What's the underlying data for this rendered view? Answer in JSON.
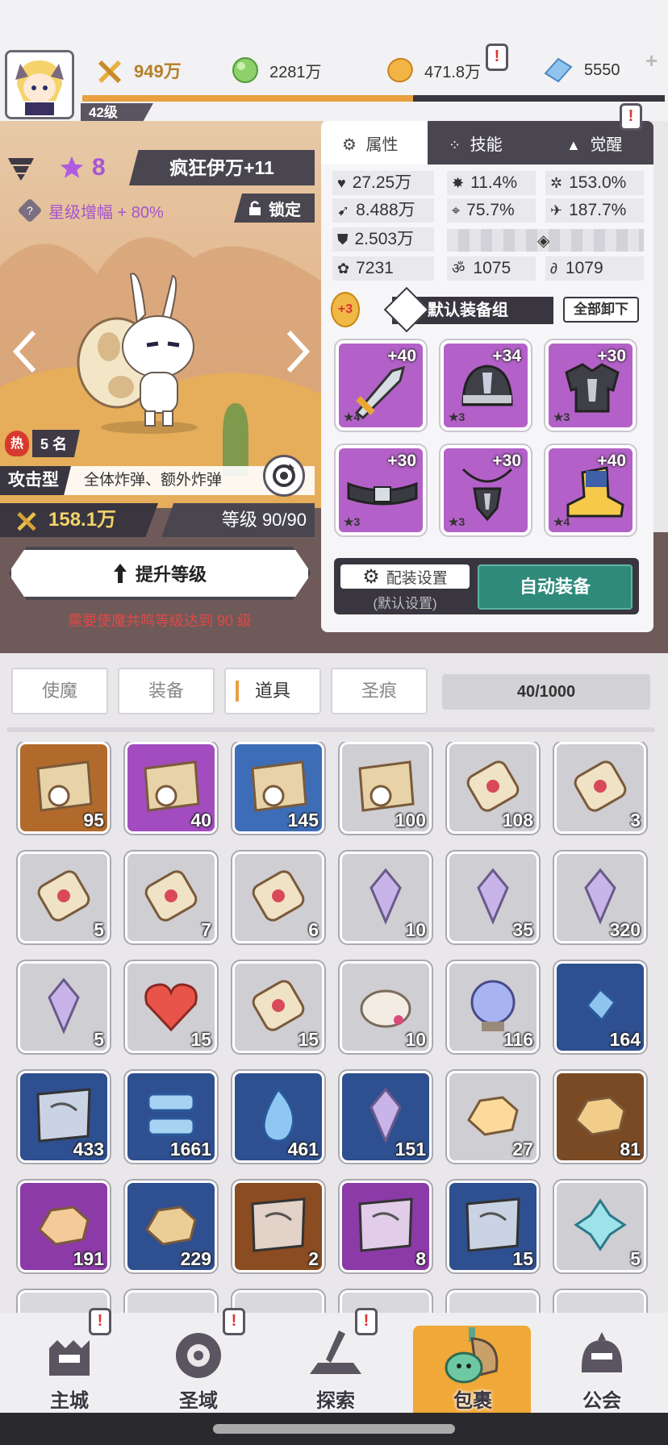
{
  "top": {
    "power": "949万",
    "level": "42级",
    "green_currency": "2281万",
    "gold": "471.8万",
    "gems": "5550",
    "alert": "!"
  },
  "hero": {
    "stars": "8",
    "name": "疯狂伊万+11",
    "star_boost": "星级增幅 + 80%",
    "lock_label": "锁定",
    "hot_label": "热",
    "rank": "5 名",
    "type": "攻击型",
    "skill_desc": "全体炸弹、额外炸弹",
    "power": "158.1万",
    "level_text": "等级 90/90",
    "upgrade_button": "提升等级",
    "requirement": "需要使魔共鸣等级达到 90 级"
  },
  "panel": {
    "tabs": [
      "属性",
      "技能",
      "觉醒"
    ],
    "stats": {
      "hp": "27.25万",
      "crit": "11.4%",
      "crit_dmg": "153.0%",
      "atk": "8.488万",
      "accuracy": "75.7%",
      "speed": "187.7%",
      "def": "2.503万",
      "s1": "7231",
      "s2": "1075",
      "s3": "1079"
    },
    "set_badge": "+3",
    "set_name": "默认装备组",
    "unequip_all": "全部卸下",
    "equipment": [
      {
        "level": "+40",
        "stars": "★4",
        "color": "#b55ac8"
      },
      {
        "level": "+34",
        "stars": "★3",
        "color": "#b55ac8"
      },
      {
        "level": "+30",
        "stars": "★3",
        "color": "#b55ac8"
      },
      {
        "level": "+30",
        "stars": "★3",
        "color": "#b55ac8"
      },
      {
        "level": "+30",
        "stars": "★3",
        "color": "#b55ac8"
      },
      {
        "level": "+40",
        "stars": "★4",
        "color": "#b55ac8"
      }
    ],
    "config_label": "配装设置",
    "config_sub": "(默认设置)",
    "auto_equip": "自动装备"
  },
  "tabs": {
    "items": [
      "使魔",
      "装备",
      "道具",
      "圣痕"
    ],
    "active": "道具",
    "capacity": "40/1000"
  },
  "inventory": [
    {
      "count": "95",
      "bg": "#b26a2c",
      "icon": "treasure-map-icon"
    },
    {
      "count": "40",
      "bg": "#a24cc0",
      "icon": "treasure-map-icon"
    },
    {
      "count": "145",
      "bg": "#3e6db8",
      "icon": "treasure-map-icon"
    },
    {
      "count": "100",
      "bg": "#cfced3",
      "icon": "treasure-map-icon"
    },
    {
      "count": "108",
      "bg": "#cfced3",
      "icon": "scroll-icon"
    },
    {
      "count": "3",
      "bg": "#cfced3",
      "icon": "scroll-icon"
    },
    {
      "count": "5",
      "bg": "#cfced3",
      "icon": "scroll-icon"
    },
    {
      "count": "7",
      "bg": "#cfced3",
      "icon": "scroll-icon"
    },
    {
      "count": "6",
      "bg": "#cfced3",
      "icon": "scroll-icon"
    },
    {
      "count": "10",
      "bg": "#cfced3",
      "icon": "crystal-icon"
    },
    {
      "count": "35",
      "bg": "#cfced3",
      "icon": "crystal-icon"
    },
    {
      "count": "320",
      "bg": "#cfced3",
      "icon": "crystal-icon"
    },
    {
      "count": "5",
      "bg": "#cfced3",
      "icon": "crystal-icon"
    },
    {
      "count": "15",
      "bg": "#cfced3",
      "icon": "heart-icon"
    },
    {
      "count": "15",
      "bg": "#cfced3",
      "icon": "scroll-icon"
    },
    {
      "count": "10",
      "bg": "#cfced3",
      "icon": "shell-icon"
    },
    {
      "count": "116",
      "bg": "#cfced3",
      "icon": "orb-icon"
    },
    {
      "count": "164",
      "bg": "#2e4f90",
      "icon": "gem-icon"
    },
    {
      "count": "433",
      "bg": "#2e4f90",
      "icon": "blueprint-icon"
    },
    {
      "count": "1661",
      "bg": "#2e4f90",
      "icon": "material-icon"
    },
    {
      "count": "461",
      "bg": "#2e4f90",
      "icon": "flame-icon"
    },
    {
      "count": "151",
      "bg": "#2e4f90",
      "icon": "crystal-icon"
    },
    {
      "count": "27",
      "bg": "#cfced3",
      "icon": "ore-icon"
    },
    {
      "count": "81",
      "bg": "#7a4a25",
      "icon": "ore-icon"
    },
    {
      "count": "191",
      "bg": "#8c3aa8",
      "icon": "ore-icon"
    },
    {
      "count": "229",
      "bg": "#2e4f90",
      "icon": "ore-icon"
    },
    {
      "count": "2",
      "bg": "#8a4c20",
      "icon": "blueprint-icon"
    },
    {
      "count": "8",
      "bg": "#8c3aa8",
      "icon": "blueprint-icon"
    },
    {
      "count": "15",
      "bg": "#2e4f90",
      "icon": "blueprint-icon"
    },
    {
      "count": "5",
      "bg": "#cfced3",
      "icon": "clover-icon"
    }
  ],
  "nav": [
    "主城",
    "圣域",
    "探索",
    "包裹",
    "公会"
  ]
}
